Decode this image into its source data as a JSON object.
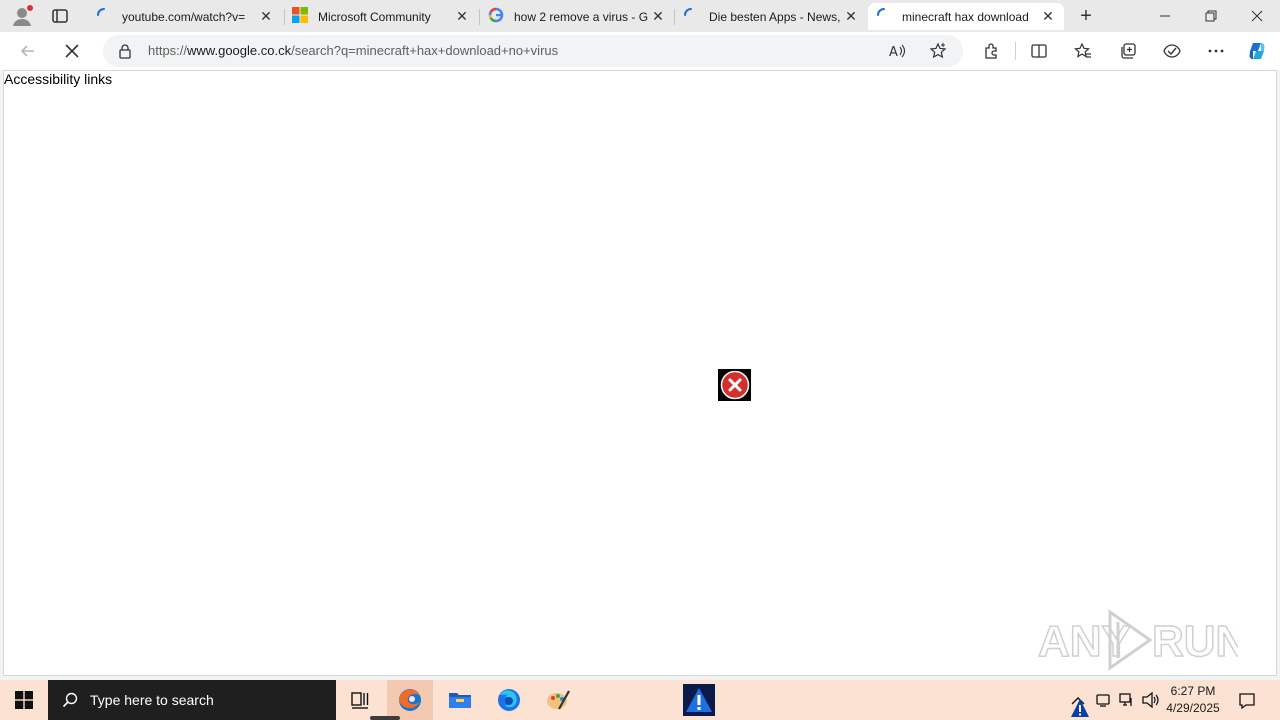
{
  "browser": {
    "tabs": [
      {
        "title": "youtube.com/watch?v=",
        "favicon": "loading-icon"
      },
      {
        "title": "Microsoft Community",
        "favicon": "microsoft-logo-icon"
      },
      {
        "title": "how 2 remove a virus - G",
        "favicon": "google-g-icon"
      },
      {
        "title": "Die besten Apps - News,",
        "favicon": "loading-icon"
      },
      {
        "title": "minecraft hax download",
        "favicon": "loading-icon",
        "active": true
      }
    ],
    "address": {
      "scheme": "https://",
      "host": "www.google.co.ck",
      "path": "/search?q=minecraft+hax+download+no+virus"
    }
  },
  "page": {
    "accessibility_links": "Accessibility links"
  },
  "watermark": {
    "left": "ANY",
    "right": "RUN"
  },
  "taskbar": {
    "search_placeholder": "Type here to search",
    "time": "6:27 PM",
    "date": "4/29/2025"
  },
  "colors": {
    "taskbar_bg": "#fbe2d3",
    "error_red": "#d32f2f",
    "copilot_blue": "#1d6fd8"
  }
}
